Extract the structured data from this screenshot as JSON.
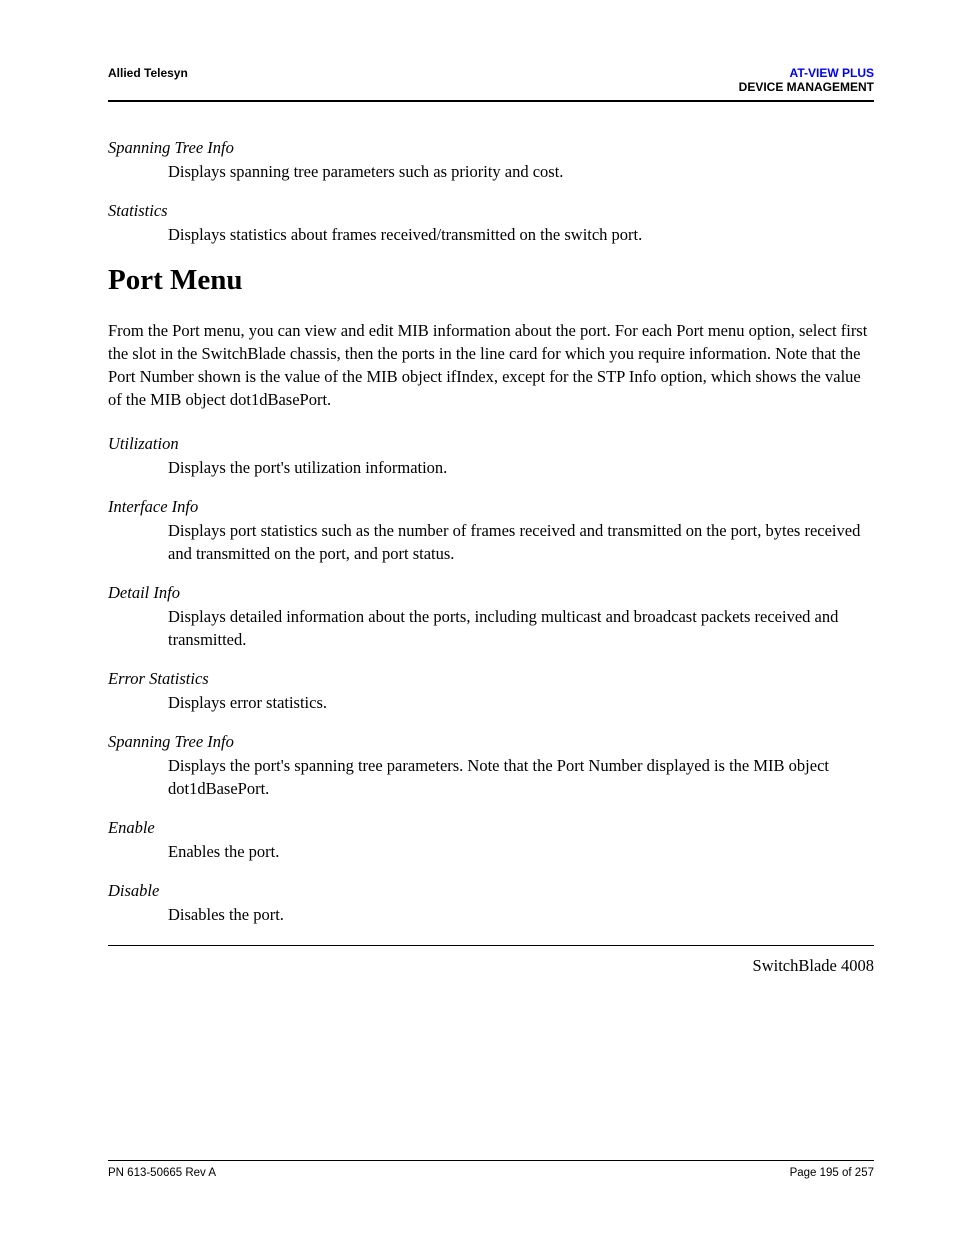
{
  "header": {
    "left": "Allied Telesyn",
    "right_line1": "AT-VIEW PLUS",
    "right_line2": "DEVICE MANAGEMENT"
  },
  "top_sections": [
    {
      "term": "Spanning Tree Info",
      "desc": "Displays spanning tree parameters such as priority and cost."
    },
    {
      "term": "Statistics",
      "desc": "Displays statistics about frames received/transmitted on the switch port."
    }
  ],
  "main_heading": "Port Menu",
  "intro": "From the Port menu, you can view and edit MIB information about the port. For each Port menu option, select first the slot in the SwitchBlade chassis, then the ports in the line card for which you require information. Note that the Port Number shown is the value of the MIB object ifIndex, except for the STP Info option, which shows the value of the MIB object dot1dBasePort.",
  "port_sections": [
    {
      "term": "Utilization",
      "desc": "Displays the port's utilization information."
    },
    {
      "term": "Interface Info",
      "desc": "Displays port statistics such as the number of frames received and transmitted on the port, bytes received and transmitted on the port, and port status."
    },
    {
      "term": "Detail Info",
      "desc": "Displays detailed information about the ports, including multicast and broadcast packets received and transmitted."
    },
    {
      "term": "Error Statistics",
      "desc": "Displays error statistics."
    },
    {
      "term": "Spanning Tree Info",
      "desc": "Displays the port's spanning tree parameters. Note that the Port Number displayed is the MIB object dot1dBasePort."
    },
    {
      "term": "Enable",
      "desc": "Enables the port."
    },
    {
      "term": "Disable",
      "desc": "Disables the port."
    }
  ],
  "device_name": "SwitchBlade 4008",
  "footer": {
    "left": "PN 613-50665 Rev A",
    "right": "Page 195 of 257"
  }
}
